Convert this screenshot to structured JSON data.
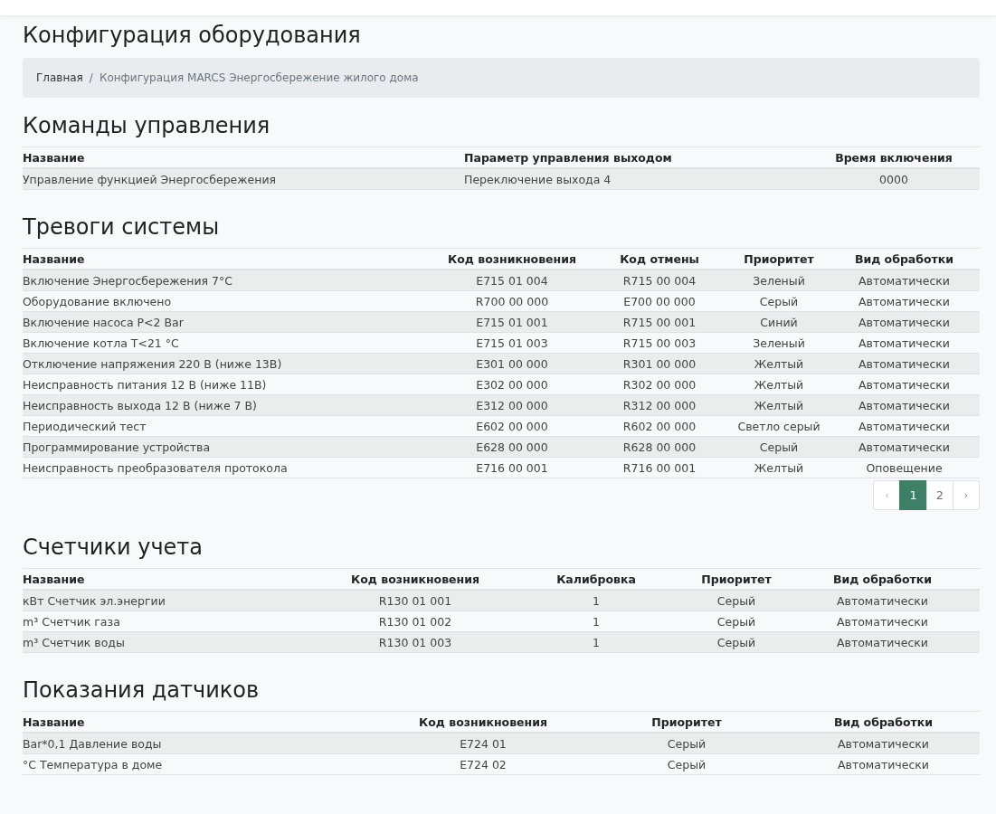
{
  "page": {
    "title": "Конфигурация оборудования"
  },
  "breadcrumb": {
    "separator": "/",
    "items": [
      {
        "label": "Главная",
        "kind": "link"
      },
      {
        "label": "Конфигурация MARCS Энергосбережение жилого дома",
        "kind": "current"
      }
    ]
  },
  "sections": [
    {
      "title": "Команды управления",
      "table": {
        "columns": [
          "Название",
          "Параметр управления выходом",
          "Время включения"
        ],
        "rows": [
          [
            "Управление функцией Энергосбережения",
            "Переключение выхода 4",
            "0000"
          ]
        ]
      }
    },
    {
      "title": "Тревоги системы",
      "table": {
        "columns": [
          "Название",
          "Код возникновения",
          "Код отмены",
          "Приоритет",
          "Вид обработки"
        ],
        "rows": [
          [
            "Включение Энергосбережения 7°C",
            "E715 01 004",
            "R715 00 004",
            "Зеленый",
            "Автоматически"
          ],
          [
            "Оборудование включено",
            "R700 00 000",
            "E700 00 000",
            "Серый",
            "Автоматически"
          ],
          [
            "Включение насоса P<2 Bar",
            "E715 01 001",
            "R715 00 001",
            "Синий",
            "Автоматически"
          ],
          [
            "Включение котла T<21 °C",
            "E715 01 003",
            "R715 00 003",
            "Зеленый",
            "Автоматически"
          ],
          [
            "Отключение напряжения 220 В (ниже 13В)",
            "E301 00 000",
            "R301 00 000",
            "Желтый",
            "Автоматически"
          ],
          [
            "Неисправность питания 12 В (ниже 11В)",
            "E302 00 000",
            "R302 00 000",
            "Желтый",
            "Автоматически"
          ],
          [
            "Неисправность выхода 12 В (ниже 7 В)",
            "E312 00 000",
            "R312 00 000",
            "Желтый",
            "Автоматически"
          ],
          [
            "Периодический тест",
            "E602 00 000",
            "R602 00 000",
            "Светло серый",
            "Автоматически"
          ],
          [
            "Программирование устройства",
            "E628 00 000",
            "R628 00 000",
            "Серый",
            "Автоматически"
          ],
          [
            "Неисправность преобразователя протокола",
            "E716 00 001",
            "R716 00 001",
            "Желтый",
            "Оповещение"
          ]
        ]
      },
      "pagination": [
        {
          "label": "‹",
          "kind": "prev",
          "selected": false,
          "disabled": true
        },
        {
          "label": "1",
          "kind": "page",
          "selected": true,
          "disabled": false
        },
        {
          "label": "2",
          "kind": "page",
          "selected": false,
          "disabled": false
        },
        {
          "label": "›",
          "kind": "next",
          "selected": false,
          "disabled": false
        }
      ]
    },
    {
      "title": "Счетчики учета",
      "table": {
        "columns": [
          "Название",
          "Код возникновения",
          "Калибровка",
          "Приоритет",
          "Вид обработки"
        ],
        "rows": [
          [
            "кВт Счетчик эл.энергии",
            "R130 01 001",
            "1",
            "Серый",
            "Автоматически"
          ],
          [
            "m³ Счетчик газа",
            "R130 01 002",
            "1",
            "Серый",
            "Автоматически"
          ],
          [
            "m³ Счетчик воды",
            "R130 01 003",
            "1",
            "Серый",
            "Автоматически"
          ]
        ]
      }
    },
    {
      "title": "Показания датчиков",
      "table": {
        "columns": [
          "Название",
          "Код возникновения",
          "Приоритет",
          "Вид обработки"
        ],
        "rows": [
          [
            "Bar*0,1 Давление воды",
            "E724 01",
            "Серый",
            "Автоматически"
          ],
          [
            "°C Температура в доме",
            "E724 02",
            "Серый",
            "Автоматически"
          ]
        ]
      }
    }
  ]
}
